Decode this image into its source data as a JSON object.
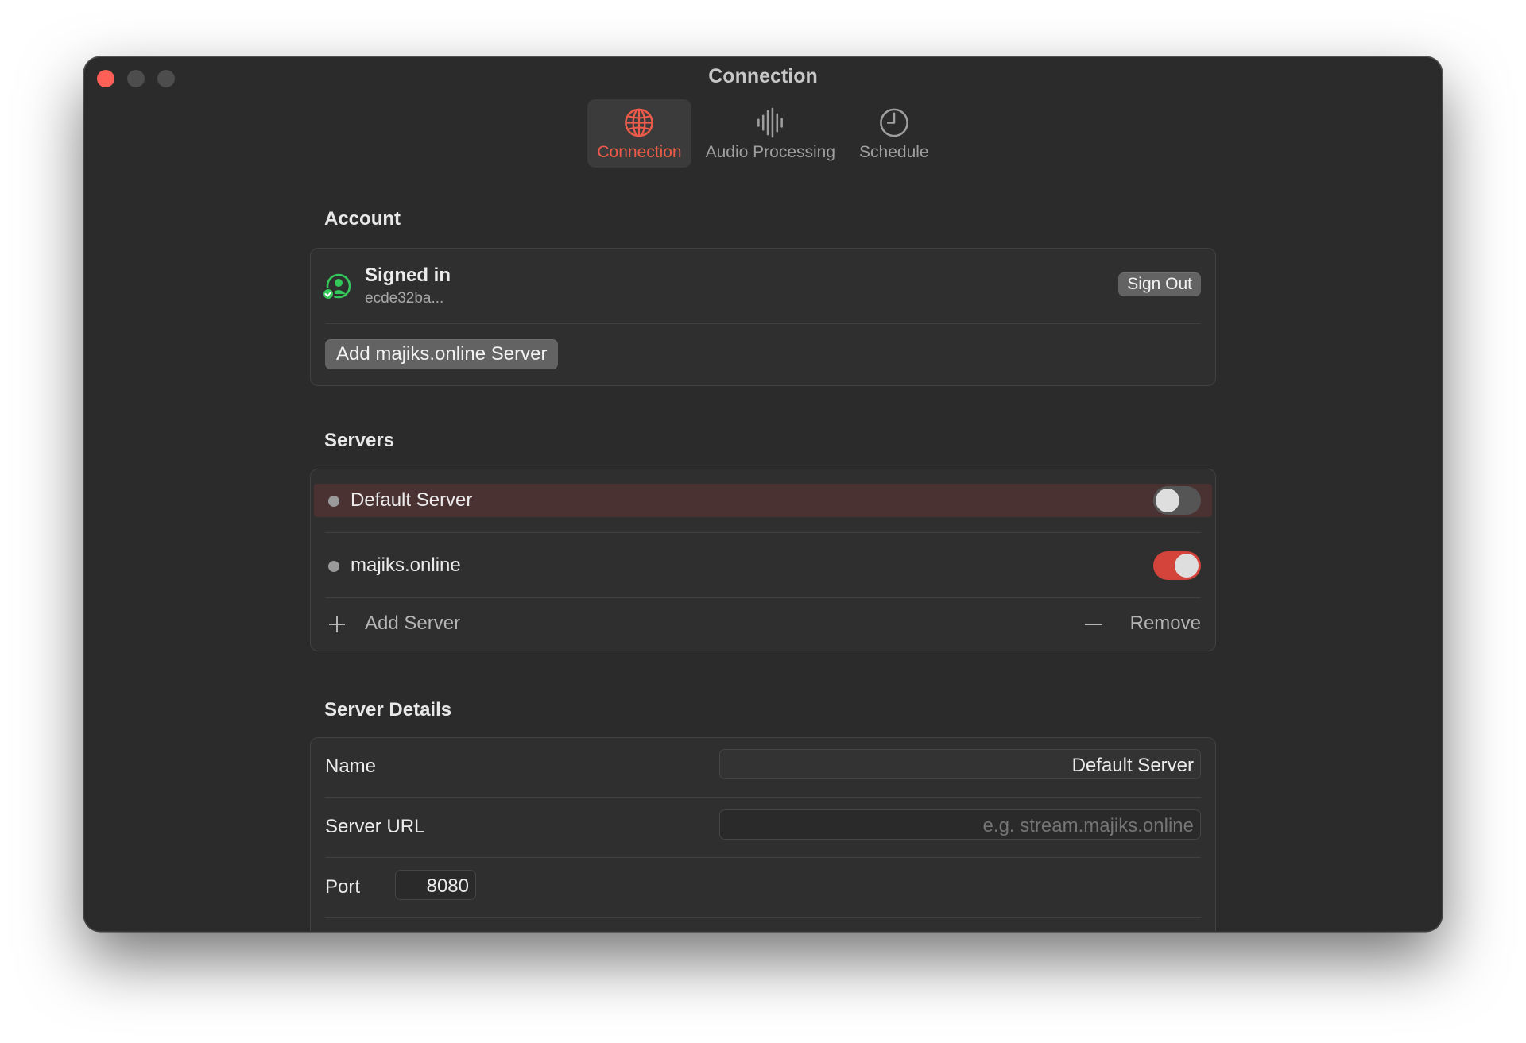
{
  "window": {
    "title": "Connection"
  },
  "toolbar": {
    "tabs": [
      {
        "label": "Connection",
        "icon": "globe-icon",
        "active": true
      },
      {
        "label": "Audio Processing",
        "icon": "waveform-icon",
        "active": false
      },
      {
        "label": "Schedule",
        "icon": "clock-icon",
        "active": false
      }
    ]
  },
  "account": {
    "title": "Account",
    "status": "Signed in",
    "user_id": "ecde32ba...",
    "sign_out_label": "Sign Out",
    "add_server_label": "Add majiks.online Server"
  },
  "servers": {
    "title": "Servers",
    "items": [
      {
        "name": "Default Server",
        "enabled": false,
        "selected": true
      },
      {
        "name": "majiks.online",
        "enabled": true,
        "selected": false
      }
    ],
    "add_label": "Add Server",
    "remove_label": "Remove"
  },
  "details": {
    "title": "Server Details",
    "name_label": "Name",
    "name_value": "Default Server",
    "url_label": "Server URL",
    "url_placeholder": "e.g. stream.majiks.online",
    "port_label": "Port",
    "port_value": "8080"
  },
  "colors": {
    "accent": "#d4443a",
    "accent_text": "#ec5a4a",
    "signed_in_green": "#34c759",
    "selection": "#4a3233",
    "window_bg": "#2b2b2b"
  }
}
